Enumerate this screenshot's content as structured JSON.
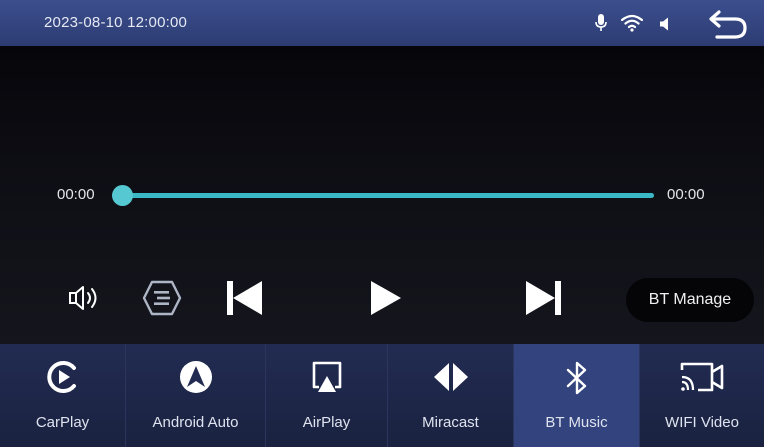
{
  "status_bar": {
    "datetime": "2023-08-10 12:00:00",
    "icons": [
      "microphone-icon",
      "wifi-icon",
      "speaker-icon",
      "back-icon"
    ]
  },
  "player": {
    "elapsed": "00:00",
    "duration": "00:00",
    "progress_fraction": 0.0,
    "controls": [
      "volume-icon",
      "playlist-icon",
      "previous-icon",
      "play-icon",
      "next-icon"
    ],
    "bt_manage_label": "BT Manage"
  },
  "dock": {
    "active": "BT Music",
    "items": [
      {
        "label": "CarPlay",
        "icon": "carplay-icon"
      },
      {
        "label": "Android Auto",
        "icon": "android-auto-icon"
      },
      {
        "label": "AirPlay",
        "icon": "airplay-icon"
      },
      {
        "label": "Miracast",
        "icon": "miracast-icon"
      },
      {
        "label": "BT Music",
        "icon": "bluetooth-icon"
      },
      {
        "label": "WIFI Video",
        "icon": "wifi-video-icon"
      }
    ]
  },
  "colors": {
    "accent": "#3ab8c5",
    "status_bar": "#33457f",
    "dock": "#1f2848",
    "dock_active": "#32437d"
  }
}
